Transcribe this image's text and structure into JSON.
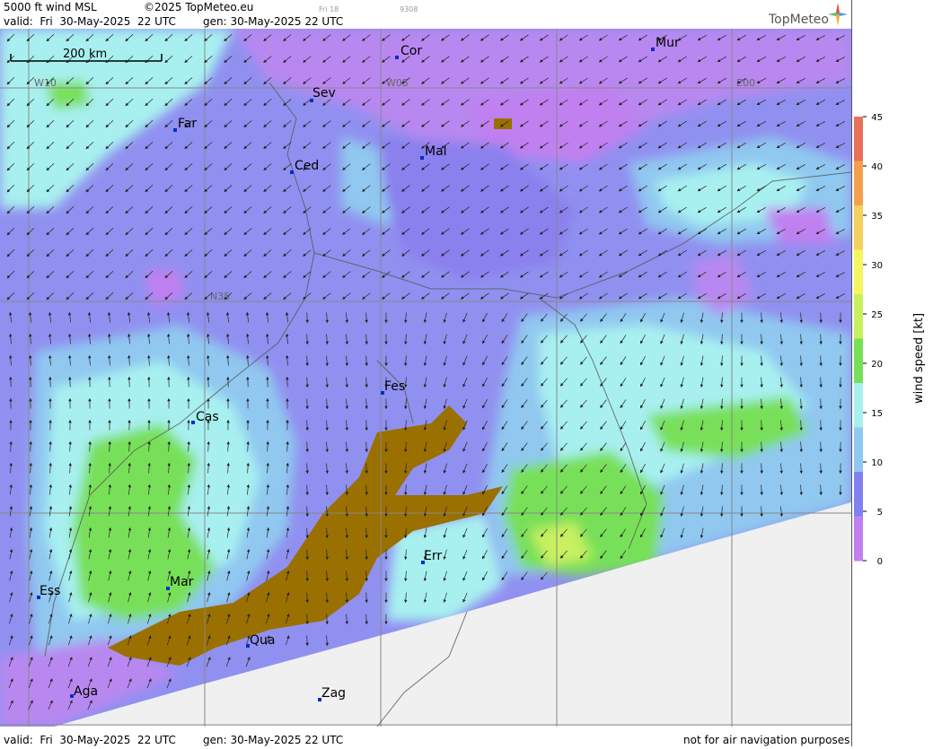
{
  "header": {
    "title": "5000 ft wind MSL",
    "copyright": "©2025 TopMeteo.eu",
    "valid": "valid:  Fri  30-May-2025  22 UTC",
    "gen": "gen: 30-May-2025 22 UTC",
    "day": "Fri 18",
    "code": "9308",
    "logo": "TopMeteo"
  },
  "footer": {
    "valid": "valid:  Fri  30-May-2025  22 UTC",
    "gen": "gen: 30-May-2025 22 UTC",
    "disclaimer": "not for air navigation purposes"
  },
  "map": {
    "scale_label": "200 km",
    "grid_labels": [
      "W10",
      "W05",
      "E00",
      "N35"
    ],
    "cities": [
      "Cor",
      "Mur",
      "Sev",
      "Far",
      "Mal",
      "Ced",
      "Fes",
      "Cas",
      "Err",
      "Mar",
      "Ess",
      "Qua",
      "Aga",
      "Zag"
    ]
  },
  "legend": {
    "title": "wind speed [kt]",
    "ticks": [
      "45",
      "40",
      "35",
      "30",
      "25",
      "20",
      "15",
      "10",
      "5",
      "0"
    ],
    "colors": [
      "#e8705a",
      "#f2a050",
      "#f5d060",
      "#f5f560",
      "#c8f060",
      "#78e058",
      "#a8f0f0",
      "#90c8f0",
      "#8080f0",
      "#c080f0"
    ]
  }
}
